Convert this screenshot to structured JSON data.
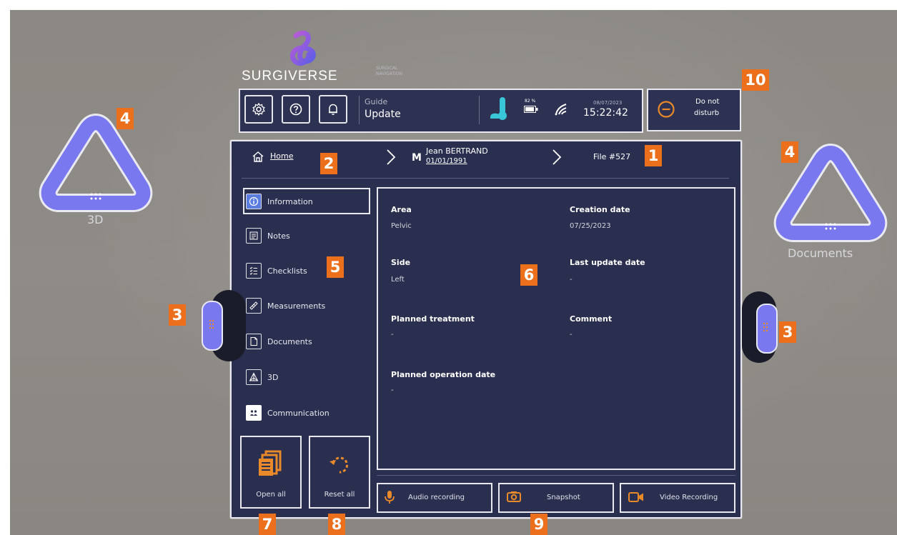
{
  "brand": {
    "name": "SURGIVERSE",
    "tagline": "SURGICAL NAVIGATION"
  },
  "topbar": {
    "guide_label": "Guide",
    "guide_value": "Update",
    "battery_percent": "82 %",
    "date": "08/07/2023",
    "time": "15:22:42",
    "icons": [
      "gear-icon",
      "help-icon",
      "bell-icon",
      "thermometer-icon",
      "battery-icon",
      "wifi-icon"
    ]
  },
  "dnd": {
    "label_line1": "Do not",
    "label_line2": "disturb"
  },
  "breadcrumb": {
    "home": "Home",
    "patient_sex": "M",
    "patient_name": "Jean BERTRAND",
    "patient_dob": "01/01/1991",
    "file": "File #527"
  },
  "sidebar": {
    "items": [
      {
        "label": "Information",
        "icon": "info-icon",
        "selected": true
      },
      {
        "label": "Notes",
        "icon": "notes-icon"
      },
      {
        "label": "Checklists",
        "icon": "checklist-icon"
      },
      {
        "label": "Measurements",
        "icon": "ruler-icon"
      },
      {
        "label": "Documents",
        "icon": "document-icon"
      },
      {
        "label": "3D",
        "icon": "3d-icon"
      },
      {
        "label": "Communication",
        "icon": "people-icon"
      }
    ]
  },
  "info": {
    "area_label": "Area",
    "area_value": "Pelvic",
    "side_label": "Side",
    "side_value": "Left",
    "treatment_label": "Planned treatment",
    "treatment_value": "-",
    "opdate_label": "Planned operation date",
    "opdate_value": "-",
    "creation_label": "Creation date",
    "creation_value": "07/25/2023",
    "update_label": "Last update date",
    "update_value": "-",
    "comment_label": "Comment",
    "comment_value": "-"
  },
  "actions": {
    "open_all": "Open all",
    "reset_all": "Reset all"
  },
  "recording": {
    "audio": "Audio recording",
    "snapshot": "Snapshot",
    "video": "Video Recording"
  },
  "side_widgets": {
    "left_label": "3D",
    "right_label": "Documents"
  },
  "markers": {
    "m1": "1",
    "m2": "2",
    "m3a": "3",
    "m3b": "3",
    "m4a": "4",
    "m4b": "4",
    "m5": "5",
    "m6": "6",
    "m7": "7",
    "m8": "8",
    "m9": "9",
    "m10": "10"
  },
  "colors": {
    "panel": "#2b2f4f",
    "accent_orange": "#e8892a",
    "accent_cyan": "#39c6d8",
    "widget_purple": "#7a78ee",
    "marker": "#ec6f1c"
  }
}
